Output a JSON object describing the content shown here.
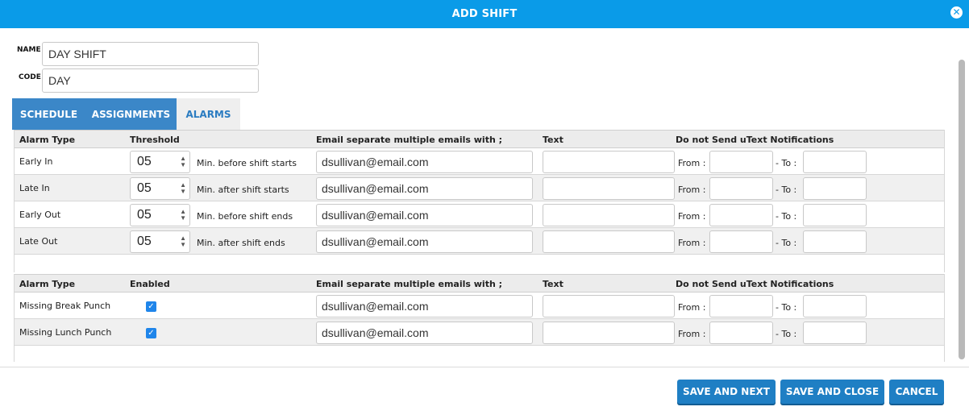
{
  "window": {
    "title": "ADD SHIFT"
  },
  "form": {
    "name_label": "NAME",
    "name_value": "DAY SHIFT",
    "code_label": "CODE",
    "code_value": "DAY"
  },
  "tabs": [
    {
      "label": "SCHEDULE"
    },
    {
      "label": "ASSIGNMENTS"
    },
    {
      "label": "ALARMS"
    }
  ],
  "threshold_table": {
    "headers": {
      "alarm_type": "Alarm Type",
      "threshold": "Threshold",
      "email": "Email separate multiple emails with ;",
      "text": "Text",
      "no_send": "Do not Send uText Notifications"
    },
    "rows": [
      {
        "alarm_type": "Early In",
        "threshold": "05",
        "desc": "Min. before shift starts",
        "email": "dsullivan@email.com"
      },
      {
        "alarm_type": "Late In",
        "threshold": "05",
        "desc": "Min. after shift starts",
        "email": "dsullivan@email.com"
      },
      {
        "alarm_type": "Early Out",
        "threshold": "05",
        "desc": "Min. before shift ends",
        "email": "dsullivan@email.com"
      },
      {
        "alarm_type": "Late Out",
        "threshold": "05",
        "desc": "Min. after shift ends",
        "email": "dsullivan@email.com"
      }
    ]
  },
  "enabled_table": {
    "headers": {
      "alarm_type": "Alarm Type",
      "enabled": "Enabled",
      "email": "Email separate multiple emails with ;",
      "text": "Text",
      "no_send": "Do not Send uText Notifications"
    },
    "rows": [
      {
        "alarm_type": "Missing Break Punch",
        "enabled": true,
        "email": "dsullivan@email.com"
      },
      {
        "alarm_type": "Missing Lunch Punch",
        "enabled": true,
        "email": "dsullivan@email.com"
      }
    ]
  },
  "labels": {
    "from": "From :",
    "to": "- To :"
  },
  "footer": {
    "save_next": "SAVE AND NEXT",
    "save_close": "SAVE AND CLOSE",
    "cancel": "CANCEL"
  },
  "colors": {
    "accent": "#0a9be8",
    "button": "#1f7fc4",
    "tab_active": "#3b87c8",
    "checkbox": "#1f85ea"
  }
}
